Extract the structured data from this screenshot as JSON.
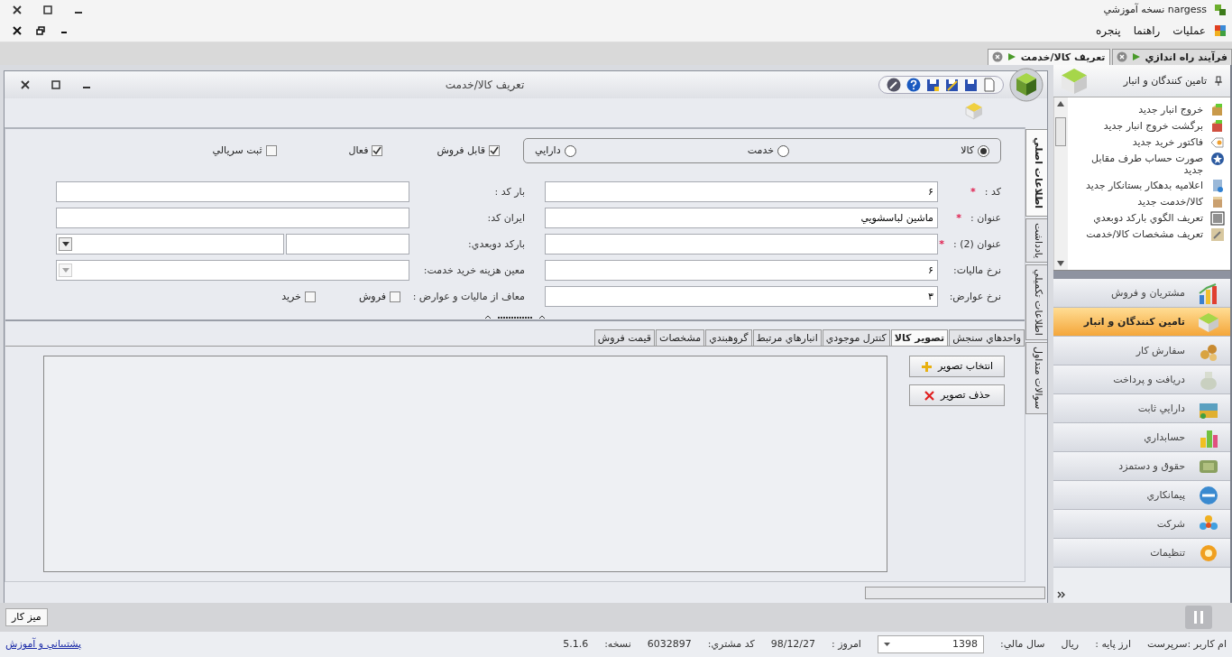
{
  "app_title": "nargess نسخه آموزشي",
  "menu": [
    "عمليات",
    "راهنما",
    "پنجره"
  ],
  "document_tabs": [
    {
      "label": "فرآيند راه اندازي",
      "selected": false
    },
    {
      "label": "تعريف کالا/خدمت",
      "selected": true
    }
  ],
  "window": {
    "title": "تعريف کالا/خدمت"
  },
  "item_type": [
    {
      "label": "کالا",
      "selected": true
    },
    {
      "label": "خدمت",
      "selected": false
    },
    {
      "label": "دارايي",
      "selected": false
    }
  ],
  "flags": [
    {
      "label": "قابل فروش",
      "checked": true
    },
    {
      "label": "فعال",
      "checked": true
    },
    {
      "label": "ثبت سريالي",
      "checked": false
    }
  ],
  "fields_right": [
    {
      "label": "کد :",
      "marker": "*",
      "value": "۶"
    },
    {
      "label": "عنوان :",
      "marker": "*",
      "value": "ماشين لباسشويي"
    },
    {
      "label": "عنوان (2) :",
      "marker": "*"
    },
    {
      "label": "نرخ ماليات:",
      "value": "۶"
    },
    {
      "label": "نرخ عوارض:",
      "value": "۳"
    }
  ],
  "fields_left": [
    {
      "label": "بار کد :",
      "kind": "text"
    },
    {
      "label": "ايران کد:",
      "kind": "text"
    },
    {
      "label": "بارکد دوبعدي:",
      "kind": "split-combo"
    },
    {
      "label": "معين هزينه خريد خدمت:",
      "kind": "combo",
      "disabled": true
    }
  ],
  "exempt": {
    "label": "معاف از ماليات و عوارض :",
    "options": [
      {
        "label": "فروش",
        "checked": false
      },
      {
        "label": "خريد",
        "checked": false
      }
    ]
  },
  "detail_tabs": [
    {
      "label": "واحدهاي سنجش",
      "selected": false
    },
    {
      "label": "تصوير کالا",
      "selected": true
    },
    {
      "label": "کنترل موجودي",
      "selected": false
    },
    {
      "label": "انبارهاي مرتبط",
      "selected": false
    },
    {
      "label": "گروهبندي",
      "selected": false
    },
    {
      "label": "مشخصات",
      "selected": false
    },
    {
      "label": "قيمت فروش",
      "selected": false
    }
  ],
  "image_buttons": [
    {
      "label": "انتخاب تصوير",
      "kind": "add"
    },
    {
      "label": "حذف تصوير",
      "kind": "delete"
    }
  ],
  "side_tabs": [
    {
      "label": "اطلاعات اصلي",
      "selected": true
    },
    {
      "label": "يادداشت",
      "selected": false
    },
    {
      "label": "اطلاعات تکميلي",
      "selected": false
    },
    {
      "label": "سوالات متداول",
      "selected": false
    }
  ],
  "sidebar": {
    "title": "تامين کنندگان و انبار",
    "items": [
      "خروج انبار جديد",
      "برگشت خروج انبار جديد",
      "فاکتور خريد جديد",
      "صورت حساب طرف مقابل جديد",
      "اعلاميه بدهکار بستانکار جديد",
      "کالا/خدمت جديد",
      "تعريف الگوي بارکد دوبعدي",
      "تعريف مشخصات کالا/خدمت"
    ],
    "modules": [
      {
        "label": "مشتريان و فروش",
        "selected": false
      },
      {
        "label": "تامين کنندگان و انبار",
        "selected": true
      },
      {
        "label": "سفارش کار",
        "selected": false
      },
      {
        "label": "دريافت و پرداخت",
        "selected": false
      },
      {
        "label": "دارايي ثابت",
        "selected": false
      },
      {
        "label": "حسابداري",
        "selected": false
      },
      {
        "label": "حقوق و دستمزد",
        "selected": false
      },
      {
        "label": "پيمانکاري",
        "selected": false
      },
      {
        "label": "شرکت",
        "selected": false
      },
      {
        "label": "تنظيمات",
        "selected": false
      }
    ]
  },
  "taskbar": {
    "button": "ميز کار"
  },
  "status_bar": {
    "items": [
      {
        "kind": "text",
        "text": "ام کاربر :سرپرست"
      },
      {
        "kind": "text",
        "text": "ارز پايه :"
      },
      {
        "kind": "text",
        "text": "ريال"
      },
      {
        "kind": "text",
        "text": "سال مالي:"
      },
      {
        "kind": "select",
        "text": "1398"
      },
      {
        "kind": "text",
        "text": "امروز :"
      },
      {
        "kind": "text",
        "text": "98/12/27"
      },
      {
        "kind": "text",
        "text": "کد مشتري:"
      },
      {
        "kind": "text",
        "text": "6032897"
      },
      {
        "kind": "text",
        "text": "نسخه:"
      },
      {
        "kind": "text",
        "text": "5.1.6"
      }
    ],
    "link": "پشتيباني و آموزش"
  }
}
